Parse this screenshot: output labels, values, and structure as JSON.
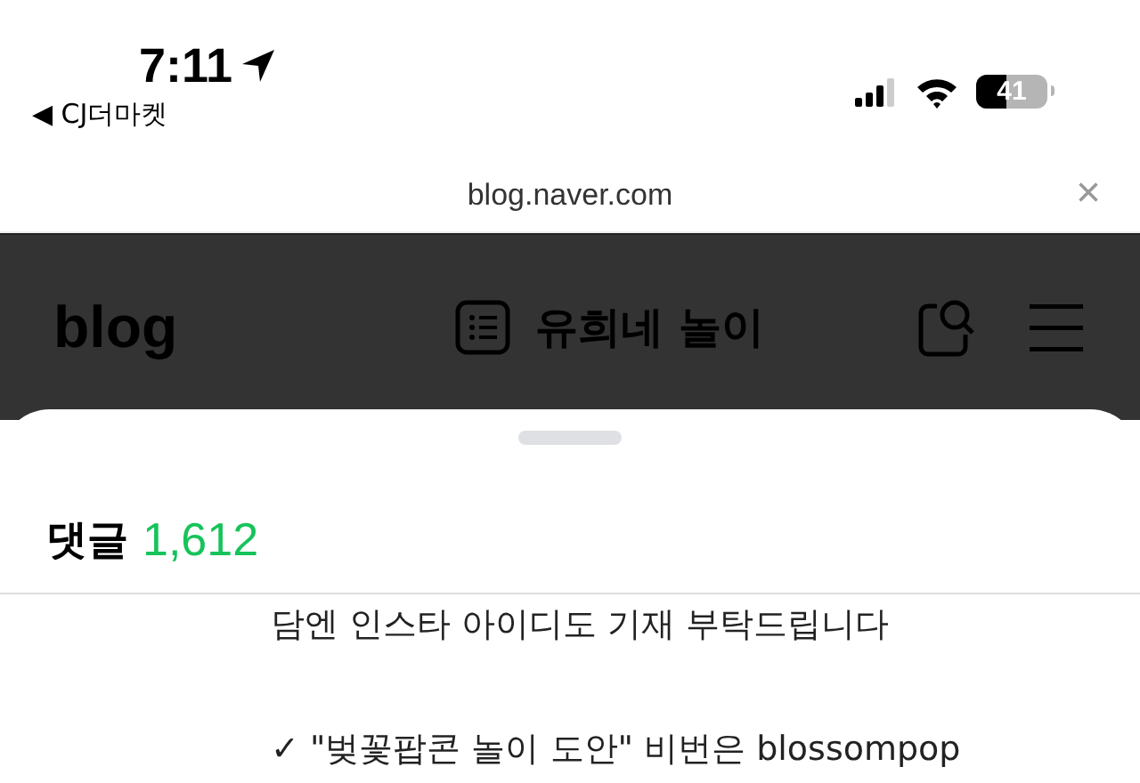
{
  "status_bar": {
    "time": "7:11",
    "back_label": "◀ CJ더마켓",
    "battery": "41"
  },
  "url_bar": {
    "url": "blog.naver.com",
    "close": "×"
  },
  "header": {
    "logo": "blog",
    "title": "유희네 놀이"
  },
  "comments_sheet": {
    "title": "댓글",
    "count": "1,612",
    "lines": [
      {
        "text": "담엔 인스타 아이디도 기재 부탁드립니다"
      },
      {
        "text": "✓ \"벚꽃팝콘 놀이 도안\" 비번은 blossompop"
      }
    ]
  }
}
